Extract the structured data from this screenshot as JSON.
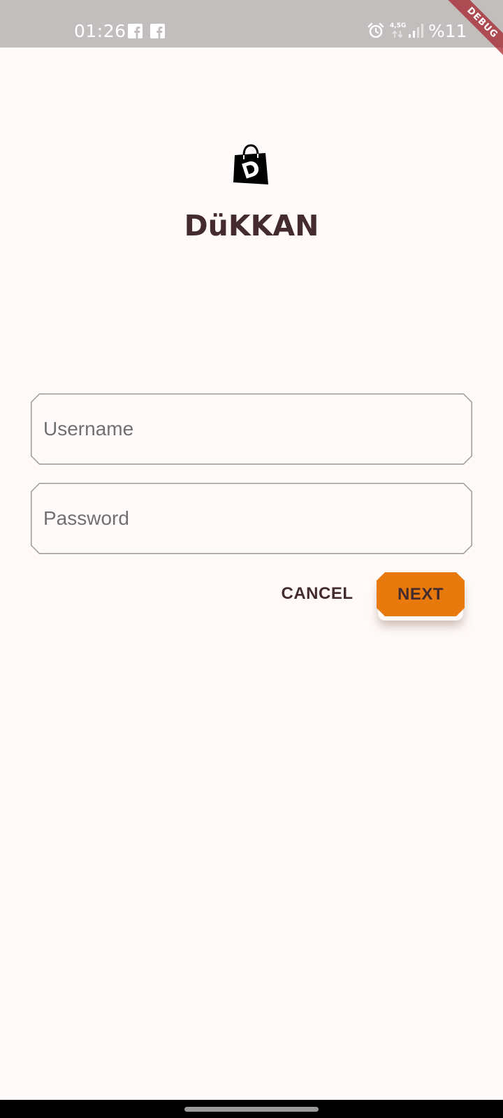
{
  "status_bar": {
    "time": "01:26",
    "network_label": "4,5G",
    "battery_text": "%11",
    "notification_icons": [
      "facebook-icon",
      "facebook-icon"
    ],
    "system_icons": [
      "alarm-icon",
      "network-arrows-icon",
      "signal-icon",
      "battery-icon"
    ]
  },
  "debug_banner": {
    "label": "DEBUG"
  },
  "app": {
    "logo_icon": "shopping-bag-icon",
    "title": "DüKKAN"
  },
  "login_form": {
    "username": {
      "placeholder": "Username",
      "value": ""
    },
    "password": {
      "placeholder": "Password",
      "value": ""
    },
    "cancel_label": "CANCEL",
    "next_label": "NEXT"
  },
  "colors": {
    "background": "#fffaf9",
    "status_bar": "#c2bebd",
    "title_text": "#442b2d",
    "accent": "#e8790c",
    "field_border": "#9e9a9a"
  }
}
